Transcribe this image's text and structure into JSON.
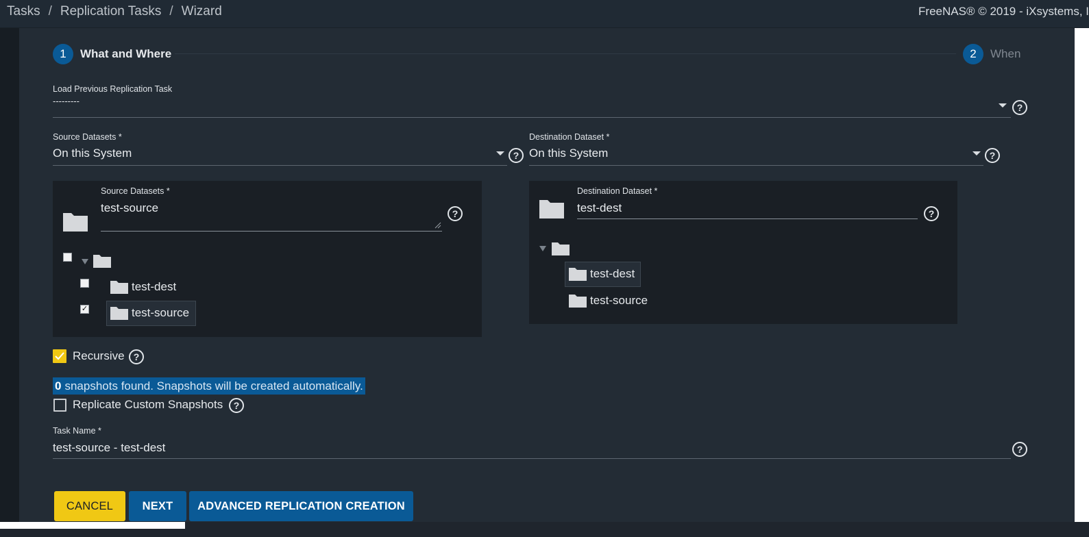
{
  "breadcrumb": [
    "Tasks",
    "Replication Tasks",
    "Wizard"
  ],
  "breadcrumb_separator": "/",
  "copyright": "FreeNAS® © 2019 - iXsystems, I",
  "stepper": {
    "steps": [
      {
        "number": "1",
        "label": "What and Where",
        "active": true
      },
      {
        "number": "2",
        "label": "When",
        "active": false
      }
    ]
  },
  "load_previous": {
    "label": "Load Previous Replication Task",
    "value": "---------"
  },
  "source_datasets_select": {
    "label": "Source Datasets *",
    "value": "On this System"
  },
  "destination_dataset_select": {
    "label": "Destination Dataset *",
    "value": "On this System"
  },
  "source_panel": {
    "label": "Source Datasets *",
    "value": "test-source",
    "tree": [
      {
        "label": "test-dest",
        "checked": false,
        "selected": false
      },
      {
        "label": "test-source",
        "checked": true,
        "selected": true
      }
    ]
  },
  "destination_panel": {
    "label": "Destination Dataset *",
    "value": "test-dest",
    "tree": [
      {
        "label": "test-dest",
        "selected": true
      },
      {
        "label": "test-source",
        "selected": false
      }
    ]
  },
  "recursive": {
    "label": "Recursive",
    "checked": true
  },
  "snapshots_note": {
    "count": "0",
    "text": "snapshots found. Snapshots will be created automatically."
  },
  "replicate_custom": {
    "label": "Replicate Custom Snapshots",
    "checked": false
  },
  "task_name": {
    "label": "Task Name *",
    "value": "test-source - test-dest"
  },
  "buttons": {
    "cancel": "CANCEL",
    "next": "NEXT",
    "advanced": "ADVANCED REPLICATION CREATION"
  },
  "colors": {
    "accent_blue": "#0a5a96",
    "accent_yellow": "#f0c814",
    "panel": "#232c35"
  },
  "help_icon_glyph": "?"
}
